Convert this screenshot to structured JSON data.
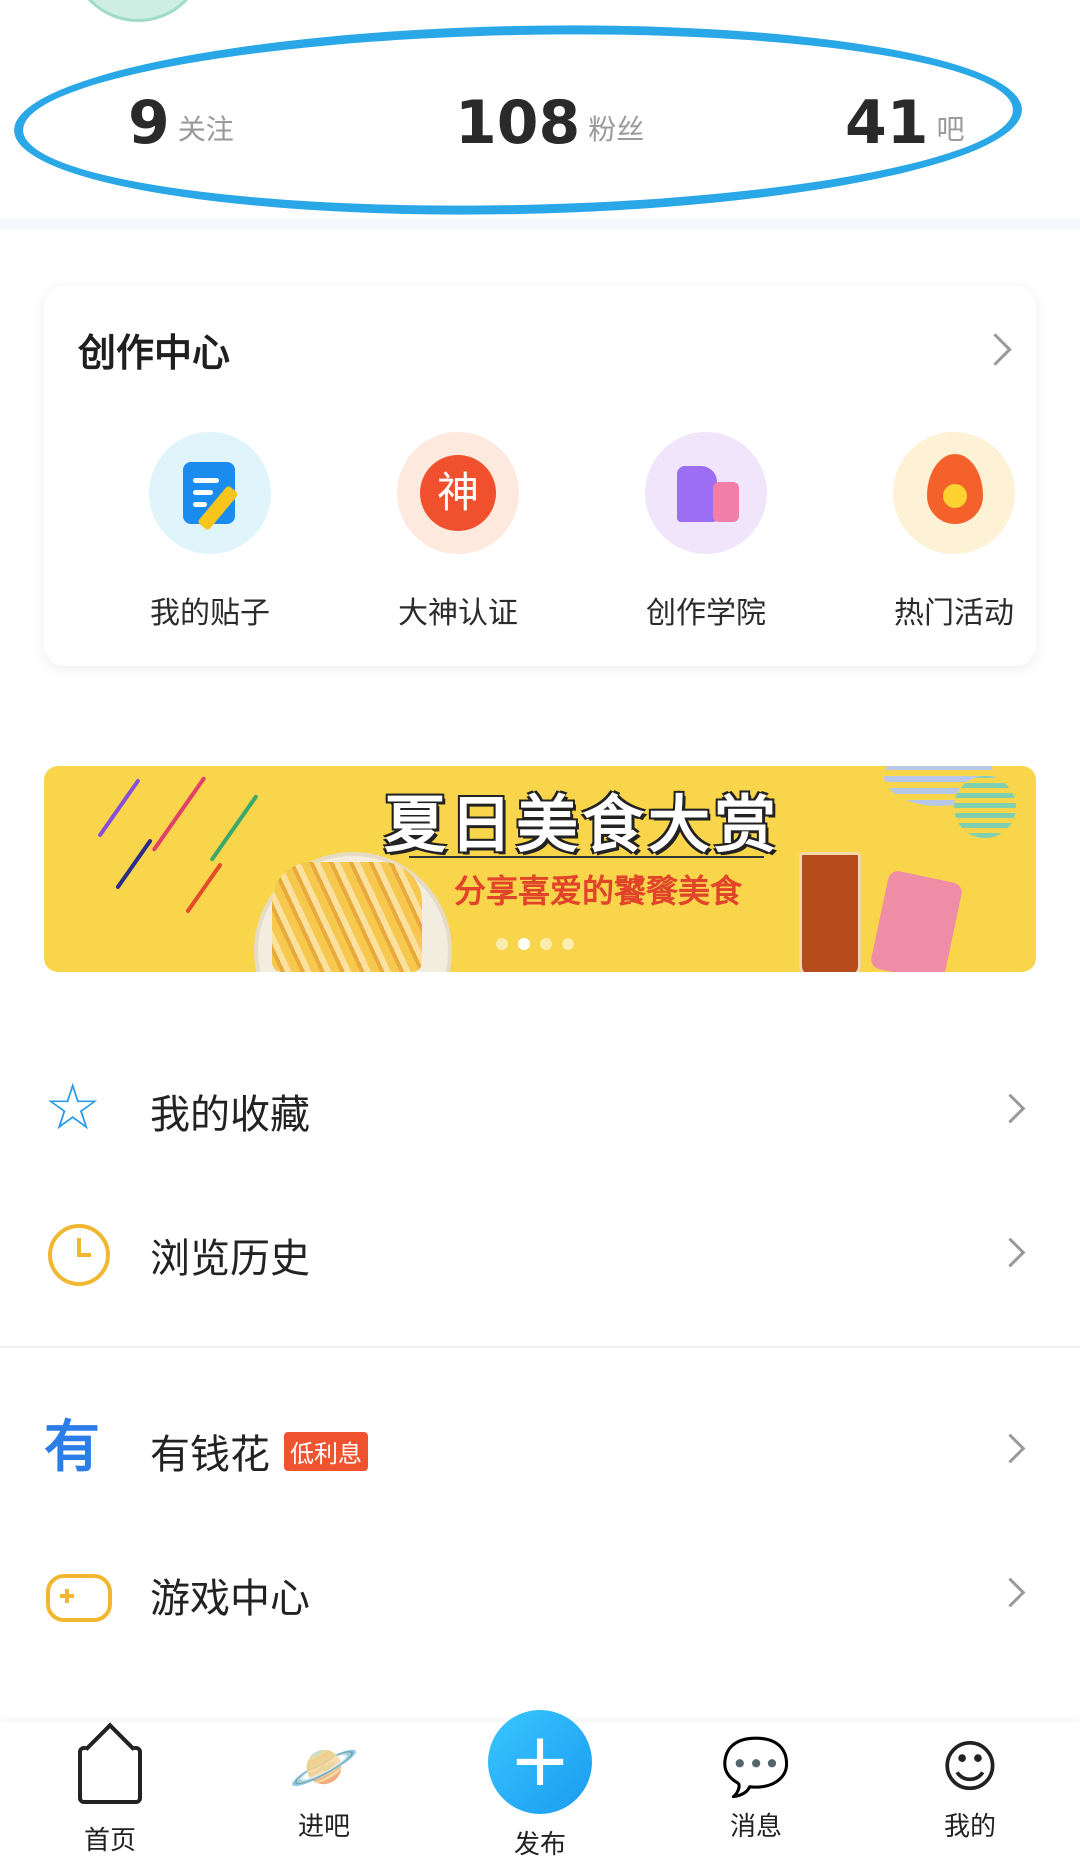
{
  "stats": {
    "follow": {
      "num": "9",
      "label": "关注"
    },
    "fans": {
      "num": "108",
      "label": "粉丝"
    },
    "bars": {
      "num": "41",
      "label": "吧"
    }
  },
  "creation_center": {
    "title": "创作中心",
    "tools": [
      {
        "label": "我的贴子",
        "icon": "post-icon"
      },
      {
        "label": "大神认证",
        "icon": "shen-badge-icon",
        "glyph": "神"
      },
      {
        "label": "创作学院",
        "icon": "academy-icon"
      },
      {
        "label": "热门活动",
        "icon": "flame-icon"
      }
    ]
  },
  "banner": {
    "title": "夏日美食大赏",
    "subtitle": "分享喜爱的饕餮美食",
    "pages": 4,
    "active_page": 2
  },
  "menu": [
    {
      "label": "我的收藏",
      "icon": "star-icon"
    },
    {
      "label": "浏览历史",
      "icon": "clock-icon"
    },
    {
      "label": "有钱花",
      "badge": "低利息",
      "icon": "money-icon",
      "icon_glyph": "有"
    },
    {
      "label": "游戏中心",
      "icon": "gamepad-icon"
    }
  ],
  "bottom_nav": {
    "home": "首页",
    "bars": "进吧",
    "publish": "发布",
    "messages": "消息",
    "mine": "我的"
  },
  "colors": {
    "accent": "#1a9bf0",
    "annotation": "#2aa7e6",
    "badge": "#f0532f",
    "banner_bg": "#f8d54a"
  }
}
